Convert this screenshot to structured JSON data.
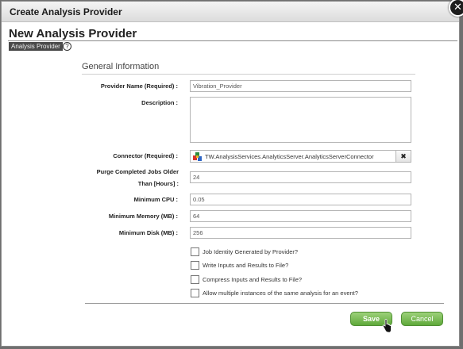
{
  "dialog": {
    "title": "Create Analysis Provider",
    "close_glyph": "✕"
  },
  "page": {
    "title": "New Analysis Provider",
    "breadcrumb": "Analysis Provider",
    "help_glyph": "?"
  },
  "section": {
    "title": "General Information"
  },
  "form": {
    "provider_name": {
      "label": "Provider Name (Required) :",
      "value": "Vibration_Provider"
    },
    "description": {
      "label": "Description :",
      "value": ""
    },
    "connector": {
      "label": "Connector (Required) :",
      "value": "TW.AnalysisServices.AnalyticsServer.AnalyticsServerConnector",
      "clear_glyph": "✖"
    },
    "purge": {
      "label_line1": "Purge Completed Jobs Older",
      "label_line2": "Than [Hours] :",
      "value": "24"
    },
    "min_cpu": {
      "label": "Minimum CPU :",
      "value": "0.05"
    },
    "min_memory": {
      "label": "Minimum Memory (MB) :",
      "value": "64"
    },
    "min_disk": {
      "label": "Minimum Disk (MB) :",
      "value": "256"
    },
    "checkboxes": [
      {
        "label": "Job Identity Generated by Provider?",
        "checked": false
      },
      {
        "label": "Write Inputs and Results to File?",
        "checked": false
      },
      {
        "label": "Compress Inputs and Results to File?",
        "checked": false
      },
      {
        "label": "Allow multiple instances of the same analysis for an event?",
        "checked": false
      }
    ]
  },
  "buttons": {
    "save": "Save",
    "cancel": "Cancel"
  },
  "icons": {
    "connector": "thingworx-connector-icon",
    "help": "help-icon",
    "close": "close-icon",
    "cursor": "hand-pointer-icon"
  },
  "colors": {
    "button_green": "#6cb444",
    "breadcrumb_bg": "#4a4a4a"
  }
}
